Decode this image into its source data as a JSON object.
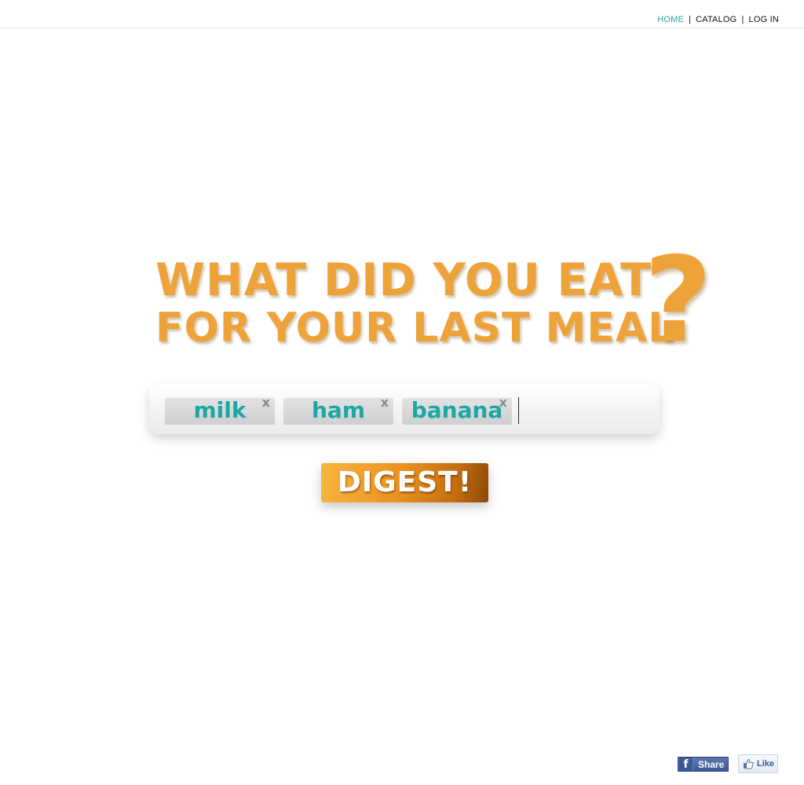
{
  "nav": {
    "items": [
      {
        "label": "HOME",
        "active": true
      },
      {
        "label": "CATALOG",
        "active": false
      },
      {
        "label": "LOG IN",
        "active": false
      }
    ],
    "separator": "|",
    "active_color": "#2aa7a0"
  },
  "headline": {
    "line1": "WHAT DID YOU EAT",
    "line2": "FOR YOUR LAST MEAL",
    "question_mark": "?",
    "color": "#eea23a"
  },
  "search": {
    "tags": [
      {
        "label": "milk",
        "remove": "x"
      },
      {
        "label": "ham",
        "remove": "x"
      },
      {
        "label": "banana",
        "remove": "x"
      }
    ],
    "tag_color": "#1ba7a3"
  },
  "digest_button": {
    "label": "DIGEST!",
    "accent": "#ec9420"
  },
  "social": {
    "share_label": "Share",
    "share_icon": "facebook-f-icon",
    "like_label": "Like",
    "like_icon": "thumbs-up-icon",
    "fb_color": "#3b5998"
  }
}
